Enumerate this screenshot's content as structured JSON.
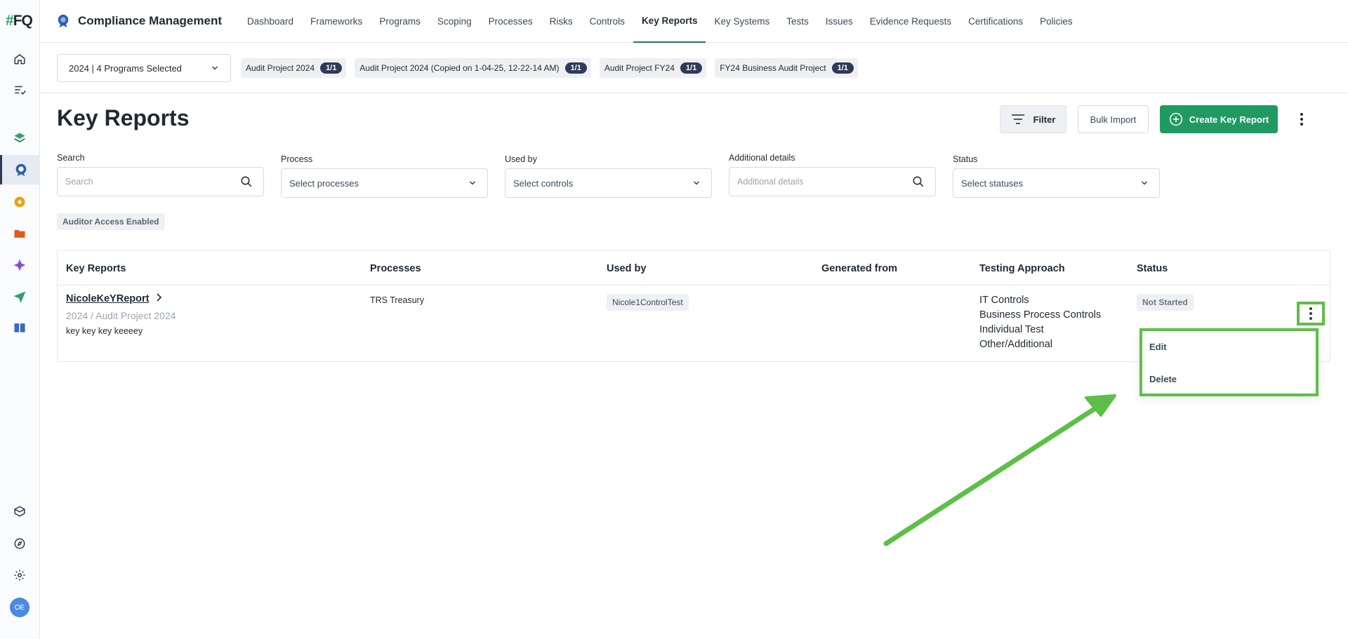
{
  "app": {
    "logo_text": "FQ",
    "title": "Compliance Management"
  },
  "leftbar": {
    "icons": [
      "home-icon",
      "list-check-icon",
      "layers-icon",
      "shield-badge-icon",
      "tag-icon",
      "folder-icon",
      "star-icon",
      "send-icon",
      "book-icon",
      "box-icon",
      "compass-icon",
      "gear-icon"
    ],
    "avatar": "OE"
  },
  "nav": {
    "items": [
      "Dashboard",
      "Frameworks",
      "Programs",
      "Scoping",
      "Processes",
      "Risks",
      "Controls",
      "Key Reports",
      "Key Systems",
      "Tests",
      "Issues",
      "Evidence Requests",
      "Certifications",
      "Policies"
    ],
    "active": "Key Reports"
  },
  "programs": {
    "selector": "2024 | 4 Programs Selected",
    "chips": [
      {
        "label": "Audit Project 2024",
        "count": "1/1"
      },
      {
        "label": "Audit Project 2024 (Copied on 1-04-25, 12-22-14 AM)",
        "count": "1/1"
      },
      {
        "label": "Audit Project FY24",
        "count": "1/1"
      },
      {
        "label": "FY24 Business Audit Project",
        "count": "1/1"
      }
    ]
  },
  "page": {
    "title": "Key Reports",
    "filter_label": "Filter",
    "bulk_import_label": "Bulk Import",
    "create_label": "Create Key Report",
    "auditor_badge": "Auditor Access Enabled"
  },
  "filters": {
    "search": {
      "label": "Search",
      "placeholder": "Search"
    },
    "process": {
      "label": "Process",
      "value": "Select processes"
    },
    "used_by": {
      "label": "Used by",
      "value": "Select controls"
    },
    "additional": {
      "label": "Additional details",
      "placeholder": "Additional details"
    },
    "status": {
      "label": "Status",
      "value": "Select statuses"
    }
  },
  "table": {
    "headers": [
      "Key Reports",
      "Processes",
      "Used by",
      "Generated from",
      "Testing Approach",
      "Status"
    ],
    "rows": [
      {
        "name": "NicoleKeYReport",
        "path": "2024 / Audit Project 2024",
        "description": "key key key keeeey",
        "process": "TRS Treasury",
        "used_by": "Nicole1ControlTest",
        "generated_from": "",
        "testing_approach": [
          "IT Controls",
          "Business Process Controls",
          "Individual Test",
          "Other/Additional"
        ],
        "status": "Not Started"
      }
    ]
  },
  "row_menu": {
    "items": [
      "Edit",
      "Delete"
    ]
  },
  "colors": {
    "primary": "#1f9a63",
    "highlight": "#5cbf47",
    "nav_active": "#1f7a5a"
  }
}
